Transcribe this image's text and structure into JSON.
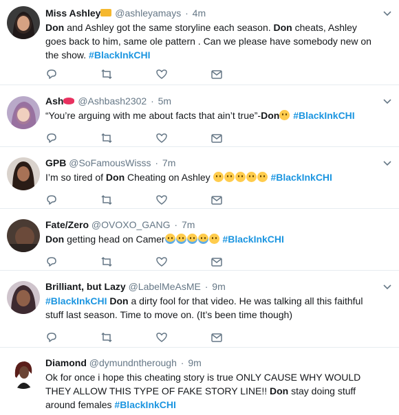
{
  "tweets": [
    {
      "name": "Miss Ashley",
      "handle": "@ashleyamays",
      "dot": "·",
      "time": "4m",
      "badge": "crown-emoji",
      "text_parts": [
        {
          "t": "Don",
          "style": "bold"
        },
        {
          "t": " and Ashley got the same storyline each season. ",
          "style": "plain"
        },
        {
          "t": "Don",
          "style": "bold"
        },
        {
          "t": " cheats, Ashley goes back to him, same ole pattern . Can we please have somebody new on the show. ",
          "style": "plain"
        },
        {
          "t": "#BlackInkCHI",
          "style": "hashtag"
        }
      ]
    },
    {
      "name": "Ash",
      "handle": "@Ashbash2302",
      "dot": "·",
      "time": "5m",
      "badge": "lips-emoji",
      "text_parts": [
        {
          "t": "“You’re arguing with me about facts that ain’t true”-",
          "style": "plain"
        },
        {
          "t": "Don",
          "style": "bold"
        },
        {
          "t": "monocle-emoji",
          "style": "emoji"
        },
        {
          "t": " ",
          "style": "plain"
        },
        {
          "t": "#BlackInkCHI",
          "style": "hashtag"
        }
      ]
    },
    {
      "name": "GPB",
      "handle": "@SoFamousWisss",
      "dot": "·",
      "time": "7m",
      "text_parts": [
        {
          "t": "I’m so tired of ",
          "style": "plain"
        },
        {
          "t": "Don",
          "style": "bold"
        },
        {
          "t": " Cheating on Ashley ",
          "style": "plain"
        },
        {
          "t": "confused-emoji",
          "style": "emoji"
        },
        {
          "t": "confused-emoji",
          "style": "emoji"
        },
        {
          "t": "confused-emoji",
          "style": "emoji"
        },
        {
          "t": "confused-emoji",
          "style": "emoji"
        },
        {
          "t": "confused-emoji",
          "style": "emoji"
        },
        {
          "t": " ",
          "style": "plain"
        },
        {
          "t": "#BlackInkCHI",
          "style": "hashtag"
        }
      ]
    },
    {
      "name": "Fate/Zero",
      "handle": "@OVOXO_GANG",
      "dot": "·",
      "time": "7m",
      "text_parts": [
        {
          "t": "Don",
          "style": "bold"
        },
        {
          "t": " getting head on Camer",
          "style": "plain"
        },
        {
          "t": "tears-of-joy-emoji",
          "style": "emoji"
        },
        {
          "t": "tears-of-joy-emoji",
          "style": "emoji"
        },
        {
          "t": "tears-of-joy-emoji",
          "style": "emoji"
        },
        {
          "t": "tears-of-joy-emoji",
          "style": "emoji"
        },
        {
          "t": "astonished-emoji",
          "style": "emoji"
        },
        {
          "t": " ",
          "style": "plain"
        },
        {
          "t": "#BlackInkCHI",
          "style": "hashtag"
        }
      ]
    },
    {
      "name": "Brilliant, but Lazy",
      "handle": "@LabelMeAsME",
      "dot": "·",
      "time": "9m",
      "text_parts": [
        {
          "t": "#BlackInkCHI",
          "style": "hashtag"
        },
        {
          "t": " ",
          "style": "plain"
        },
        {
          "t": "Don",
          "style": "bold"
        },
        {
          "t": " a dirty fool for that video. He was talking all this faithful stuff last season. Time to move on. (It’s been time though)",
          "style": "plain"
        }
      ]
    },
    {
      "name": "Diamond",
      "handle": "@dymundntherough",
      "dot": "·",
      "time": "9m",
      "text_parts": [
        {
          "t": "Ok for once i hope this cheating story is true ONLY CAUSE WHY WOULD THEY ALLOW THIS TYPE OF FAKE STORY LINE!! ",
          "style": "plain"
        },
        {
          "t": "Don",
          "style": "bold"
        },
        {
          "t": " stay doing stuff around females ",
          "style": "plain"
        },
        {
          "t": "#BlackInkCHI",
          "style": "hashtag"
        }
      ]
    }
  ],
  "colors": {
    "hashtag": "#1b95e0",
    "secondary": "#657786",
    "divider": "#e6ecf0"
  },
  "icons": [
    "reply-icon",
    "retweet-icon",
    "like-icon",
    "direct-message-icon",
    "chevron-down-icon"
  ]
}
